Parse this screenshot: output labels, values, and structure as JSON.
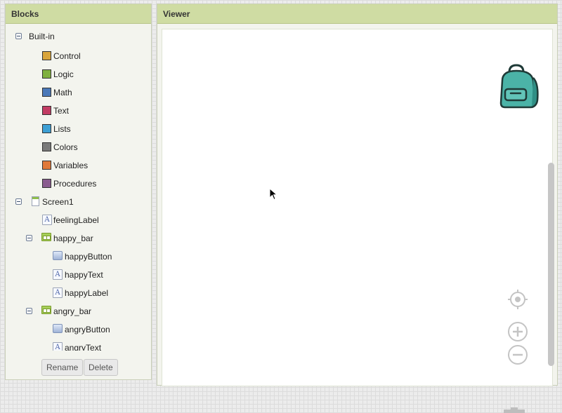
{
  "blocks_panel": {
    "title": "Blocks",
    "builtin": {
      "label": "Built-in",
      "items": [
        {
          "label": "Control",
          "color": "#d9a53b"
        },
        {
          "label": "Logic",
          "color": "#7fb03e"
        },
        {
          "label": "Math",
          "color": "#4a78b8"
        },
        {
          "label": "Text",
          "color": "#c23b63"
        },
        {
          "label": "Lists",
          "color": "#3d9fd4"
        },
        {
          "label": "Colors",
          "color": "#7a7a7a"
        },
        {
          "label": "Variables",
          "color": "#e0793a"
        },
        {
          "label": "Procedures",
          "color": "#8a5c8f"
        }
      ]
    },
    "screen": {
      "label": "Screen1",
      "children": {
        "feeling_label": "feelingLabel",
        "happy_bar": {
          "label": "happy_bar",
          "items": [
            "happyButton",
            "happyText",
            "happyLabel"
          ]
        },
        "angry_bar": {
          "label": "angry_bar",
          "items": [
            "angryButton",
            "angryText"
          ]
        }
      }
    },
    "buttons": {
      "rename": "Rename",
      "delete": "Delete"
    }
  },
  "viewer_panel": {
    "title": "Viewer"
  },
  "colors": {
    "header": "#cfdca3",
    "backpack": "#4bb3a7",
    "scrollbar": "#c6c6c6"
  },
  "icons": [
    "collapse-toggle-icon",
    "label-component-icon",
    "horizontal-arrangement-icon",
    "button-component-icon",
    "backpack-icon",
    "recenter-icon",
    "zoom-in-icon",
    "zoom-out-icon",
    "mouse-cursor-icon"
  ]
}
